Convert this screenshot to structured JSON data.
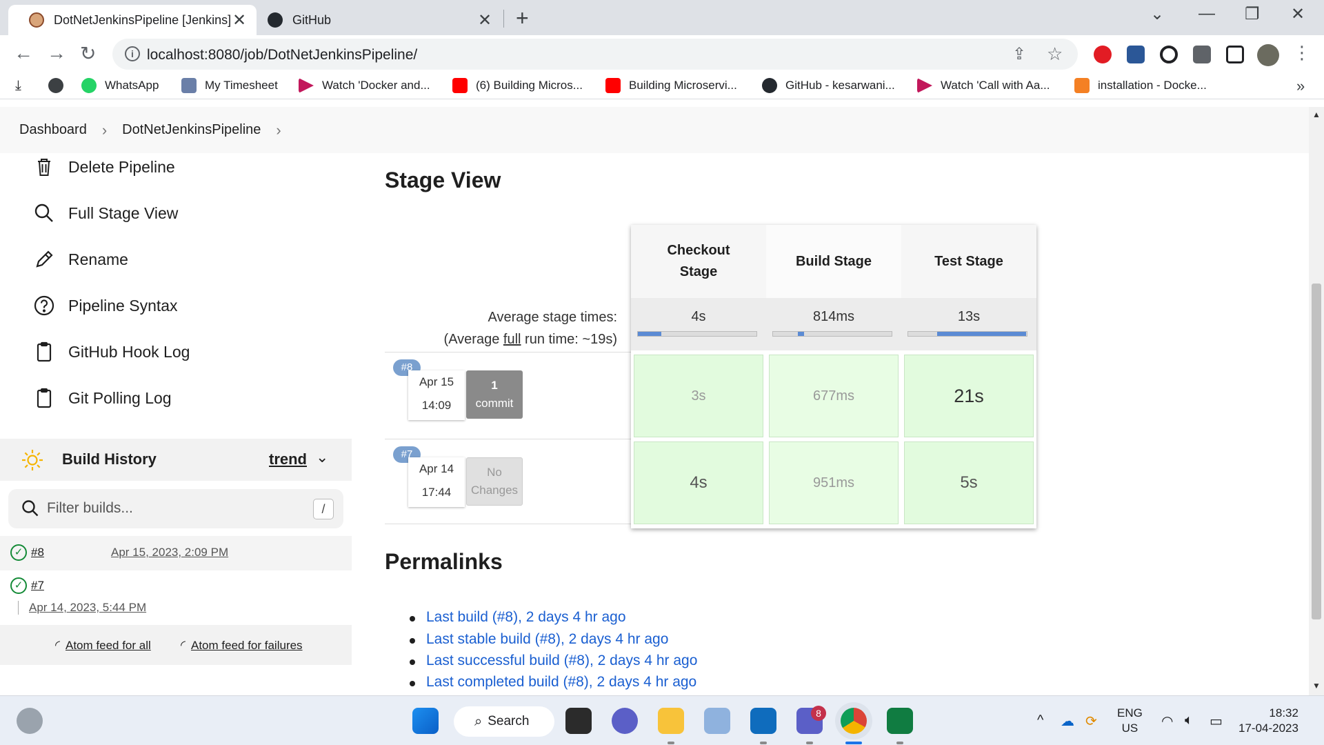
{
  "browser": {
    "tabs": [
      {
        "title": "DotNetJenkinsPipeline [Jenkins]",
        "active": true
      },
      {
        "title": "GitHub",
        "active": false
      }
    ],
    "url": "localhost:8080/job/DotNetJenkinsPipeline/",
    "bookmarks": [
      "WhatsApp",
      "My Timesheet",
      "Watch 'Docker and...",
      "(6) Building Micros...",
      "Building Microservi...",
      "GitHub - kesarwani...",
      "Watch 'Call with Aa...",
      "installation - Docke..."
    ]
  },
  "breadcrumb": {
    "items": [
      "Dashboard",
      "DotNetJenkinsPipeline"
    ]
  },
  "tasks": [
    {
      "label": "Delete Pipeline",
      "icon": "trash-icon"
    },
    {
      "label": "Full Stage View",
      "icon": "search-icon"
    },
    {
      "label": "Rename",
      "icon": "pencil-icon"
    },
    {
      "label": "Pipeline Syntax",
      "icon": "help-circle-icon"
    },
    {
      "label": "GitHub Hook Log",
      "icon": "clipboard-icon"
    },
    {
      "label": "Git Polling Log",
      "icon": "clipboard-icon"
    }
  ],
  "build_history": {
    "title": "Build History",
    "trend_label": "trend",
    "filter_placeholder": "Filter builds...",
    "filter_shortcut": "/",
    "builds": [
      {
        "number": "#8",
        "date": "Apr 15, 2023, 2:09 PM",
        "status": "success"
      },
      {
        "number": "#7",
        "date": "Apr 14, 2023, 5:44 PM",
        "status": "success"
      }
    ],
    "feeds": [
      "Atom feed for all",
      "Atom feed for failures"
    ]
  },
  "stage_view": {
    "title": "Stage View",
    "avg_label_line1": "Average stage times:",
    "avg_label_line2_prefix": "(Average ",
    "avg_label_line2_link": "full",
    "avg_label_line2_suffix": " run time: ~19s)",
    "stages": [
      {
        "name_line1": "Checkout",
        "name_line2": "Stage",
        "avg": "4s",
        "avg_bar_fraction": 0.2
      },
      {
        "name_line1": "Build Stage",
        "name_line2": "",
        "avg": "814ms",
        "avg_bar_fraction": 0.05
      },
      {
        "name_line1": "Test Stage",
        "name_line2": "",
        "avg": "13s",
        "avg_bar_fraction": 0.75
      }
    ],
    "runs": [
      {
        "badge": "#8",
        "date": "Apr 15",
        "time": "14:09",
        "commit_line1": "1",
        "commit_line2": "commit",
        "cells": [
          "3s",
          "677ms",
          "21s"
        ]
      },
      {
        "badge": "#7",
        "date": "Apr 14",
        "time": "17:44",
        "commit_line1": "No",
        "commit_line2": "Changes",
        "cells": [
          "4s",
          "951ms",
          "5s"
        ]
      }
    ]
  },
  "permalinks": {
    "title": "Permalinks",
    "items": [
      "Last build (#8), 2 days 4 hr ago",
      "Last stable build (#8), 2 days 4 hr ago",
      "Last successful build (#8), 2 days 4 hr ago",
      "Last completed build (#8), 2 days 4 hr ago"
    ]
  },
  "taskbar": {
    "search_label": "Search",
    "teams_badge": "8",
    "lang_line1": "ENG",
    "lang_line2": "US",
    "time": "18:32",
    "date": "17-04-2023"
  },
  "colors": {
    "stage_success": "#e2fbde",
    "avg_bar": "#5b8bd4",
    "link": "#1a5fd1",
    "success_check": "#138a36"
  }
}
